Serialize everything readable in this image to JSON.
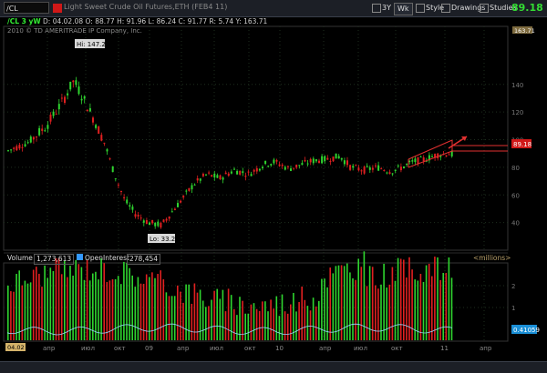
{
  "toolbar": {
    "symbol": "/CL",
    "title": "Light Sweet Crude Oil Futures,ETH (FEB4 11)",
    "period": "3Y",
    "wk": "Wk",
    "style": "Style",
    "drawings": "Drawings",
    "studies": "Studies",
    "last": "89.18"
  },
  "quote": {
    "sym": "/CL 3 yW",
    "date_label": "D:",
    "date": "04.02.08",
    "open_label": "O:",
    "open": "88.77",
    "high_label": "H:",
    "high": "91.96",
    "low_label": "L:",
    "low": "86.24",
    "close_label": "C:",
    "close": "91.77",
    "range_label": "R:",
    "range": "5.74",
    "y_label": "Y:",
    "y": "163.71"
  },
  "copyright": "2010 © TD AMERITRADE IP Company, Inc.",
  "price_axis": {
    "top_tag": "163.71",
    "ticks": [
      "140",
      "120",
      "100",
      "80",
      "60",
      "40"
    ],
    "last_tag": "89.18"
  },
  "annotations": {
    "hi": "Hi: 147.27",
    "lo": "Lo: 33.2"
  },
  "volume": {
    "label": "Volume",
    "value": "1,273,613",
    "oi_label": "OpenInterest",
    "oi_value": "278,454",
    "unit": "<millions>",
    "ticks": [
      "2",
      "1"
    ],
    "oi_tag": "0.41059"
  },
  "x_axis": {
    "start_tag": "04.02",
    "labels": [
      "апр",
      "июл",
      "окт",
      "09",
      "апр",
      "июл",
      "окт",
      "10",
      "апр",
      "июл",
      "окт",
      "11",
      "апр"
    ]
  },
  "colors": {
    "up": "#2fd52f",
    "down": "#e02020",
    "accent": "#33dd33"
  }
}
